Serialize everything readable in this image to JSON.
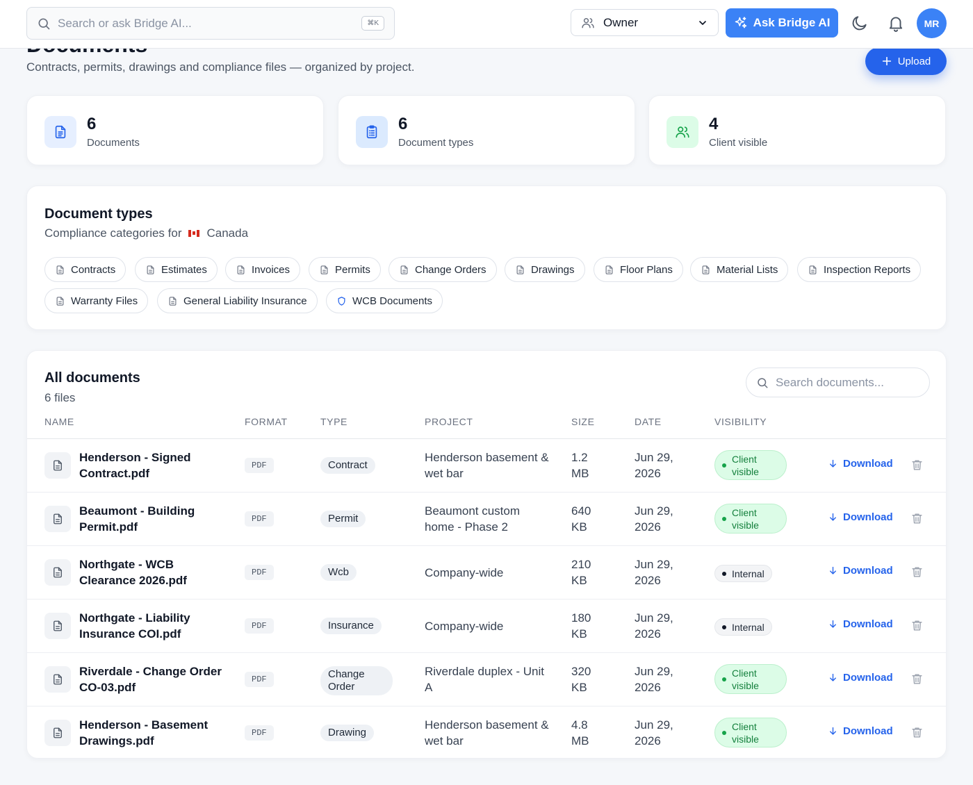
{
  "topbar": {
    "search_placeholder": "Search or ask Bridge AI...",
    "shortcut": "⌘K",
    "role": "Owner",
    "ask_label": "Ask Bridge AI",
    "avatar_initials": "MR"
  },
  "header": {
    "title": "Documents",
    "subtitle": "Contracts, permits, drawings and compliance files — organized by project.",
    "upload_label": "Upload"
  },
  "stats": [
    {
      "value": "6",
      "label": "Documents",
      "icon": "document-icon"
    },
    {
      "value": "6",
      "label": "Document types",
      "icon": "clipboard-list-icon"
    },
    {
      "value": "4",
      "label": "Client visible",
      "icon": "users-icon"
    }
  ],
  "doc_types": {
    "title": "Document types",
    "subtitle_prefix": "Compliance categories for",
    "country": "Canada",
    "chips": [
      "Contracts",
      "Estimates",
      "Invoices",
      "Permits",
      "Change Orders",
      "Drawings",
      "Floor Plans",
      "Material Lists",
      "Inspection Reports",
      "Warranty Files",
      "General Liability Insurance",
      "WCB Documents"
    ]
  },
  "documents": {
    "title": "All documents",
    "count_label": "6 files",
    "search_placeholder": "Search documents...",
    "columns": [
      "NAME",
      "FORMAT",
      "TYPE",
      "PROJECT",
      "SIZE",
      "DATE",
      "VISIBILITY"
    ],
    "download_label": "Download",
    "rows": [
      {
        "name": "Henderson - Signed Contract.pdf",
        "format": "PDF",
        "type": "Contract",
        "project": "Henderson basement & wet bar",
        "size": "1.2 MB",
        "date": "Jun 29, 2026",
        "visibility": "Client visible"
      },
      {
        "name": "Beaumont - Building Permit.pdf",
        "format": "PDF",
        "type": "Permit",
        "project": "Beaumont custom home - Phase 2",
        "size": "640 KB",
        "date": "Jun 29, 2026",
        "visibility": "Client visible"
      },
      {
        "name": "Northgate - WCB Clearance 2026.pdf",
        "format": "PDF",
        "type": "Wcb",
        "project": "Company-wide",
        "size": "210 KB",
        "date": "Jun 29, 2026",
        "visibility": "Internal"
      },
      {
        "name": "Northgate - Liability Insurance COI.pdf",
        "format": "PDF",
        "type": "Insurance",
        "project": "Company-wide",
        "size": "180 KB",
        "date": "Jun 29, 2026",
        "visibility": "Internal"
      },
      {
        "name": "Riverdale - Change Order CO-03.pdf",
        "format": "PDF",
        "type": "Change Order",
        "project": "Riverdale duplex - Unit A",
        "size": "320 KB",
        "date": "Jun 29, 2026",
        "visibility": "Client visible"
      },
      {
        "name": "Henderson - Basement Drawings.pdf",
        "format": "PDF",
        "type": "Drawing",
        "project": "Henderson basement & wet bar",
        "size": "4.8 MB",
        "date": "Jun 29, 2026",
        "visibility": "Client visible"
      }
    ]
  },
  "colors": {
    "primary": "#3b82f6",
    "primary_dark": "#2563eb",
    "client_visible_bg": "#dcfce7",
    "client_visible_text": "#15803d",
    "page_bg": "#f5f7fa"
  }
}
